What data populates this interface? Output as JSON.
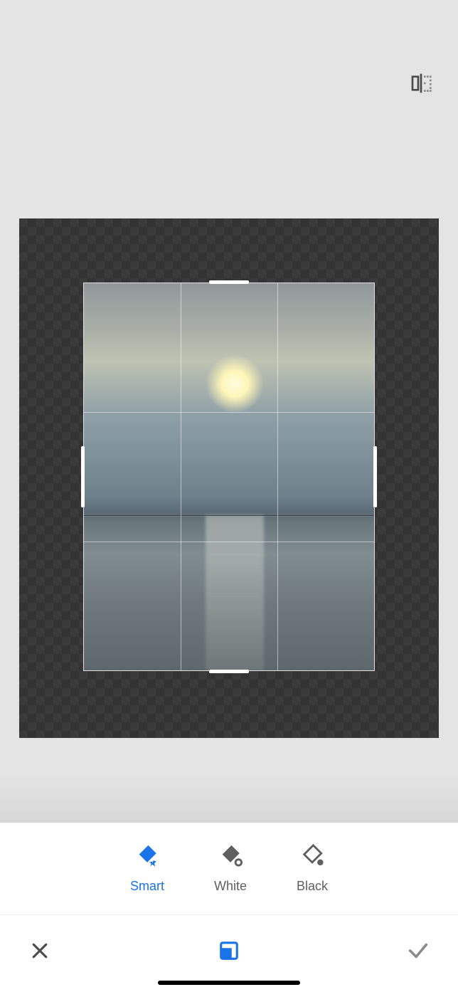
{
  "header": {
    "flip_icon": "flip-horizontal-icon"
  },
  "canvas": {
    "image_description": "sunset over calm sea with cloudy sky",
    "grid": "rule-of-thirds"
  },
  "fill_options": {
    "items": [
      {
        "key": "smart",
        "label": "Smart",
        "active": true
      },
      {
        "key": "white",
        "label": "White",
        "active": false
      },
      {
        "key": "black",
        "label": "Black",
        "active": false
      }
    ]
  },
  "bottom_bar": {
    "cancel_icon": "close-icon",
    "tool_icon": "expand-canvas-icon",
    "confirm_icon": "check-icon"
  },
  "colors": {
    "accent": "#1a73e8",
    "icon_muted": "#5f5f5f"
  }
}
